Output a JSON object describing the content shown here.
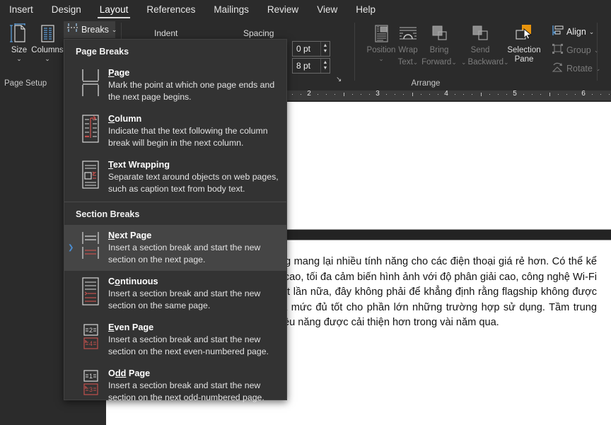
{
  "ribbon": {
    "tabs": [
      {
        "label": "Insert",
        "active": false
      },
      {
        "label": "Design",
        "active": false
      },
      {
        "label": "Layout",
        "active": true
      },
      {
        "label": "References",
        "active": false
      },
      {
        "label": "Mailings",
        "active": false
      },
      {
        "label": "Review",
        "active": false
      },
      {
        "label": "View",
        "active": false
      },
      {
        "label": "Help",
        "active": false
      }
    ],
    "page_setup": {
      "group_label": "Page Setup",
      "size_label": "Size",
      "size_caret": "⌄",
      "columns_label": "Columns",
      "columns_caret": "⌄",
      "breaks_label": "Breaks",
      "breaks_caret": "⌄"
    },
    "paragraph": {
      "indent_label": "Indent",
      "spacing_label": "Spacing",
      "before_value": "0 pt",
      "after_value": "8 pt",
      "dialog_launcher": "↘"
    },
    "arrange": {
      "group_label": "Arrange",
      "position_label": "Position",
      "position_caret": "⌄",
      "wrap_text_label_line1": "Wrap",
      "wrap_text_label_line2": "Text",
      "wrap_caret": "⌄",
      "bring_forward_line1": "Bring",
      "bring_forward_line2": "Forward",
      "bring_caret": "⌄",
      "send_backward_line1": "Send",
      "send_backward_line2": "Backward",
      "send_caret_left": "⌄",
      "send_caret": "⌄",
      "selection_pane_line1": "Selection",
      "selection_pane_line2": "Pane",
      "align_label": "Align",
      "align_caret": "⌄",
      "group_btn_label": "Group",
      "group_caret": "⌄",
      "rotate_label": "Rotate",
      "rotate_caret": "⌄"
    }
  },
  "ruler": {
    "numbers": [
      "2",
      "3",
      "4",
      "5",
      "6"
    ]
  },
  "menu": {
    "section1_header": "Page Breaks",
    "section2_header": "Section Breaks",
    "items": [
      {
        "id": "page",
        "title_pre": "",
        "title_key": "P",
        "title_post": "age",
        "desc": "Mark the point at which one page ends and the next page begins.",
        "icon": "page-break-icon",
        "selected": false
      },
      {
        "id": "column",
        "title_pre": "",
        "title_key": "C",
        "title_post": "olumn",
        "desc": "Indicate that the text following the column break will begin in the next column.",
        "icon": "column-break-icon",
        "selected": false
      },
      {
        "id": "text-wrapping",
        "title_pre": "",
        "title_key": "T",
        "title_post": "ext Wrapping",
        "desc": "Separate text around objects on web pages, such as caption text from body text.",
        "icon": "text-wrapping-break-icon",
        "selected": false
      },
      {
        "id": "next-page",
        "title_pre": "",
        "title_key": "N",
        "title_post": "ext Page",
        "desc": "Insert a section break and start the new section on the next page.",
        "icon": "next-page-break-icon",
        "selected": true
      },
      {
        "id": "continuous",
        "title_pre": "C",
        "title_key": "o",
        "title_post": "ntinuous",
        "desc": "Insert a section break and start the new section on the same page.",
        "icon": "continuous-break-icon",
        "selected": false
      },
      {
        "id": "even-page",
        "title_pre": "",
        "title_key": "E",
        "title_post": "ven Page",
        "desc": "Insert a section break and start the new section on the next even-numbered page.",
        "icon": "even-page-break-icon",
        "selected": false
      },
      {
        "id": "odd-page",
        "title_pre": "O",
        "title_key": "dd",
        "title_post": " Page",
        "desc": "Insert a section break and start the new section on the next odd-numbered page.",
        "icon": "odd-page-break-icon",
        "selected": false
      }
    ]
  },
  "document": {
    "body_text": "năng, những con chip tầm trung cũng mang lại nhiều tính năng cho các điện thoại giá rẻ hơn. Có thể kể đến là hỗ trợ màn hình độ phân giải cao, tối đa cảm biến hình ảnh với độ phân giải cao, công nghệ Wi-Fi và các kết nối LTE nhanh chóng. Một lần nữa, đây không phải để khẳng định rằng flagship không được cải thiện, nhưng chúng đã vượt quá mức đủ tốt cho phần lớn những trường hợp sử dụng. Tầm trung bây giờ đã đạt được mốc đó, giúp hiệu năng được cải thiện hơn trong vài năm qua."
  },
  "colors": {
    "app_bg": "#2b2b2b",
    "menu_bg": "#333333",
    "menu_sel": "#454545",
    "accent_orange": "#e8940c",
    "accent_blue": "#4b8fd4",
    "icon_red": "#c0504d",
    "page_white": "#ffffff"
  }
}
